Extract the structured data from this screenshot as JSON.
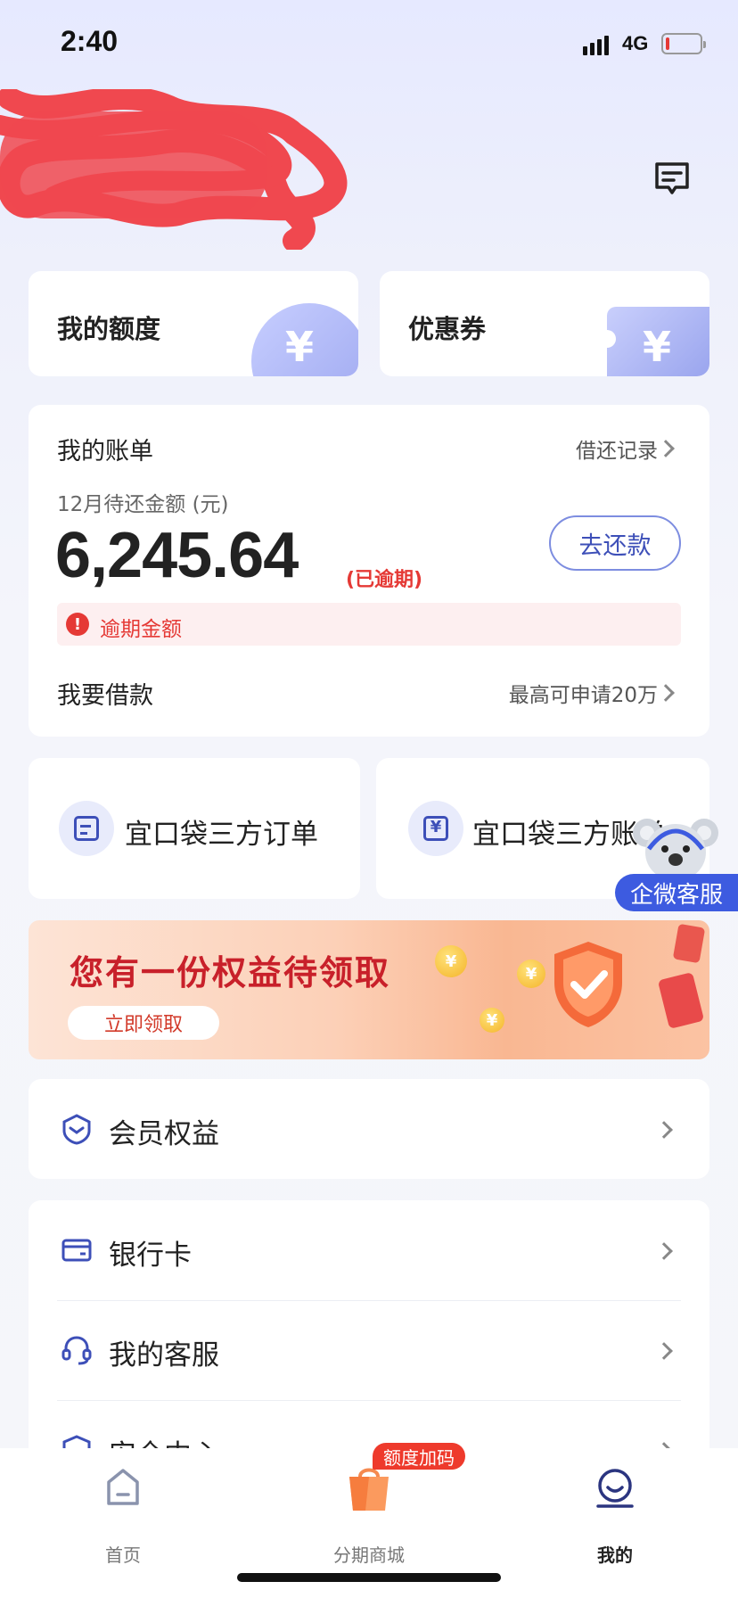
{
  "status_bar": {
    "time": "2:40",
    "network": "4G"
  },
  "header": {
    "message_icon": "message-icon"
  },
  "top_cards": {
    "quota_title": "我的额度",
    "coupon_title": "优惠券"
  },
  "bill": {
    "title": "我的账单",
    "history_link": "借还记录",
    "period_label": "12月待还金额 (元)",
    "amount": "6,245.64",
    "overdue_tag": "(已逾期)",
    "repay_button": "去还款",
    "overdue_notice": "逾期金额",
    "borrow_label": "我要借款",
    "borrow_limit": "最高可申请20万"
  },
  "shortcuts": {
    "orders": "宜口袋三方订单",
    "bills": "宜口袋三方账单"
  },
  "support_float": {
    "label": "企微客服"
  },
  "banner": {
    "title": "您有一份权益待领取",
    "button": "立即领取"
  },
  "menu": {
    "member": "会员权益",
    "bank_card": "银行卡",
    "service": "我的客服",
    "security": "安全中心"
  },
  "tabbar": {
    "home": "首页",
    "mall": "分期商城",
    "mine": "我的",
    "promo_badge": "额度加码"
  },
  "colors": {
    "accent": "#3d4fb8",
    "danger": "#e53935",
    "float_blue": "#3d5be0"
  }
}
